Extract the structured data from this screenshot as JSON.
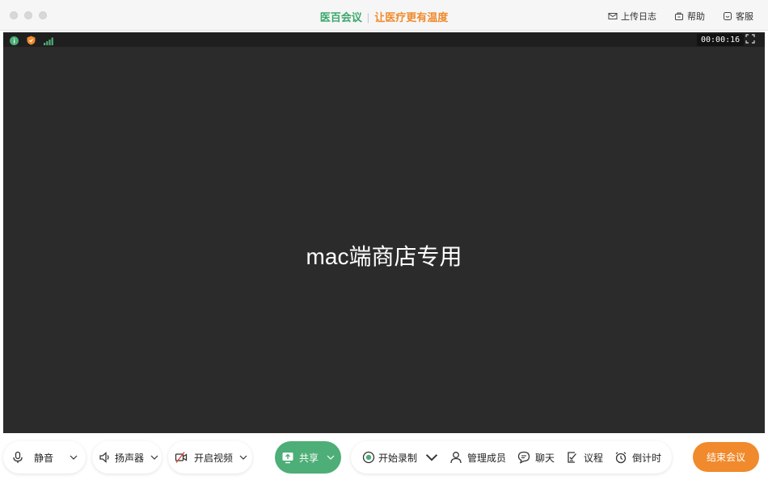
{
  "window": {
    "brand_name": "医百会议",
    "separator": "|",
    "slogan": "让医疗更有温度"
  },
  "top_actions": [
    {
      "label": "上传日志",
      "icon": "mail-icon"
    },
    {
      "label": "帮助",
      "icon": "help-bag-icon"
    },
    {
      "label": "客服",
      "icon": "support-icon"
    }
  ],
  "stage": {
    "timer": "00:00:16",
    "center_text": "mac端商店专用"
  },
  "toolbar": {
    "mute_label": "静音",
    "speaker_label": "扬声器",
    "video_label": "开启视频",
    "share_label": "共享",
    "record_label": "开始录制",
    "members_label": "管理成员",
    "chat_label": "聊天",
    "agenda_label": "议程",
    "countdown_label": "倒计时",
    "end_label": "结束会议"
  },
  "colors": {
    "brand_green": "#3aa86b",
    "accent_orange": "#f08a2c",
    "share_green": "#4dae77",
    "stage_bg": "#2b2b2b"
  }
}
